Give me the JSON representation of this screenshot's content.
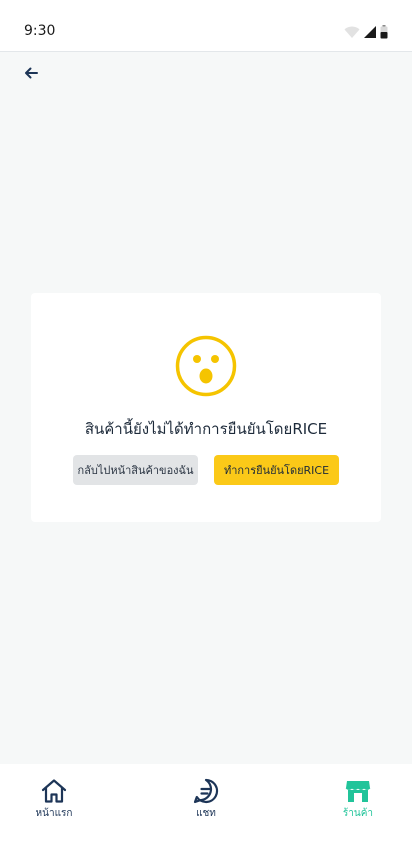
{
  "status_bar": {
    "time": "9:30"
  },
  "header": {
    "back_icon": "arrow-left-icon"
  },
  "card": {
    "emoji_icon": "surprised-face-icon",
    "message": "สินค้านี้ยังไม่ได้ทำการยืนยันโดยRICE",
    "secondary_button": "กลับไปหน้าสินค้าของฉัน",
    "primary_button": "ทำการยืนยันโดยRICE"
  },
  "bottom_nav": {
    "items": [
      {
        "label": "หน้าแรก",
        "icon": "home-icon",
        "active": false
      },
      {
        "label": "แชท",
        "icon": "chat-icon",
        "active": false
      },
      {
        "label": "ร้านค้า",
        "icon": "store-icon",
        "active": true
      }
    ]
  },
  "colors": {
    "primary": "#fbc918",
    "active_nav": "#21c49a",
    "navy": "#1d3557",
    "emoji": "#f5c400"
  }
}
